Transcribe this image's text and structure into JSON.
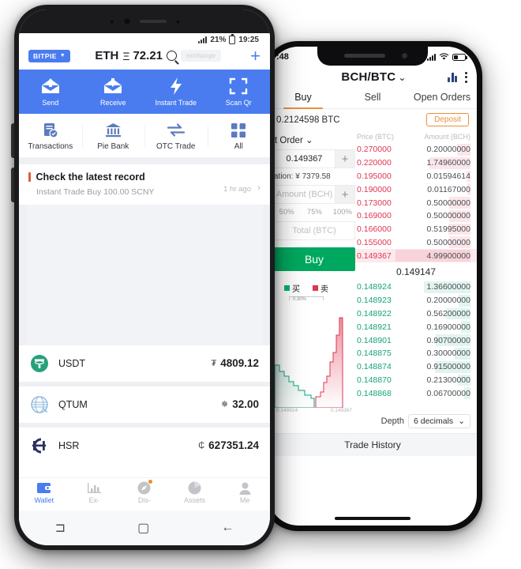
{
  "android": {
    "status": {
      "signal": "signal-bars",
      "battery_pct": "21%",
      "time": "19:25"
    },
    "header": {
      "wallet_chip": "BITPIE",
      "price_label": "ETH",
      "price_symbol": "Ξ",
      "price_value": "72.21",
      "search_placeholder": "exchange",
      "add_label": "+"
    },
    "actions": [
      {
        "label": "Send",
        "icon": "send-icon"
      },
      {
        "label": "Receive",
        "icon": "receive-icon"
      },
      {
        "label": "Instant Trade",
        "icon": "lightning-icon"
      },
      {
        "label": "Scan Qr",
        "icon": "scan-icon"
      }
    ],
    "quick": [
      {
        "label": "Transactions",
        "icon": "transactions-icon"
      },
      {
        "label": "Pie Bank",
        "icon": "bank-icon"
      },
      {
        "label": "OTC Trade",
        "icon": "exchange-arrows-icon"
      },
      {
        "label": "All",
        "icon": "grid-icon"
      }
    ],
    "record": {
      "title": "Check the latest record",
      "subtitle": "Instant Trade Buy 100.00 SCNY",
      "time": "1 hr ago",
      "chevron": "›"
    },
    "coins": [
      {
        "name": "USDT",
        "symbol": "₮",
        "amount": "4809.12",
        "color": "#26a17b",
        "icon": "usdt-icon"
      },
      {
        "name": "QTUM",
        "symbol": "✵",
        "amount": "32.00",
        "color": "#8ab9dd",
        "icon": "qtum-icon"
      },
      {
        "name": "HSR",
        "symbol": "₵",
        "amount": "627351.24",
        "color": "#2d3160",
        "icon": "hsr-icon"
      }
    ],
    "tabbar": [
      {
        "label": "Wallet",
        "icon": "wallet-icon",
        "active": true,
        "badge": false
      },
      {
        "label": "Ex-",
        "icon": "chart-icon",
        "active": false,
        "badge": false
      },
      {
        "label": "Dis-",
        "icon": "compass-icon",
        "active": false,
        "badge": true
      },
      {
        "label": "Assets",
        "icon": "pie-icon",
        "active": false,
        "badge": false
      },
      {
        "label": "Me",
        "icon": "person-icon",
        "active": false,
        "badge": false
      }
    ],
    "navbar": [
      {
        "icon": "recent-apps-icon",
        "glyph": "⊐"
      },
      {
        "icon": "home-icon",
        "glyph": "▢"
      },
      {
        "icon": "back-icon",
        "glyph": "←"
      }
    ]
  },
  "iphone": {
    "status": {
      "time": ":48",
      "signal": "signal-bars",
      "wifi": "wifi-icon",
      "battery": "battery-icon"
    },
    "header": {
      "pair": "BCH/BTC",
      "chevron": "⌄",
      "chart_icon": "chart-icon",
      "menu_icon": "kebab-menu-icon"
    },
    "tabs": [
      {
        "label": "Buy",
        "active": true
      },
      {
        "label": "Sell",
        "active": false
      },
      {
        "label": "Open Orders",
        "active": false
      }
    ],
    "balance": {
      "amount": "0.2124598 BTC",
      "deposit_label": "Deposit"
    },
    "form": {
      "order_type": "t Order",
      "order_type_chevron": "⌄",
      "price_value": "0.149367",
      "plus": "+",
      "valuation": "ation: ¥ 7379.58",
      "amount_placeholder": "Amount (BCH)",
      "percentages": [
        "50%",
        "75%",
        "100%"
      ],
      "total_placeholder": "Total (BTC)",
      "submit_label": "Buy"
    },
    "legend": [
      {
        "label": "买",
        "color": "#00b36b"
      },
      {
        "label": "卖",
        "color": "#e03552"
      }
    ],
    "scale_label": "0.30%",
    "depth_axis": [
      "0.148924",
      "0.149367"
    ],
    "orderbook": {
      "col_price": "Price (BTC)",
      "col_amount": "Amount (BCH)",
      "last_price": "0.149147",
      "sells": [
        {
          "price": "0.270000",
          "amount": "0.20000000",
          "bar": 18
        },
        {
          "price": "0.220000",
          "amount": "1.74960000",
          "bar": 55
        },
        {
          "price": "0.195000",
          "amount": "0.01594614",
          "bar": 5
        },
        {
          "price": "0.190000",
          "amount": "0.01167000",
          "bar": 4
        },
        {
          "price": "0.173000",
          "amount": "0.50000000",
          "bar": 28
        },
        {
          "price": "0.169000",
          "amount": "0.50000000",
          "bar": 28
        },
        {
          "price": "0.166000",
          "amount": "0.51995000",
          "bar": 29
        },
        {
          "price": "0.155000",
          "amount": "0.50000000",
          "bar": 28
        },
        {
          "price": "0.149367",
          "amount": "4.99900000",
          "bar": 100
        }
      ],
      "buys": [
        {
          "price": "0.148924",
          "amount": "1.36600000",
          "bar": 62
        },
        {
          "price": "0.148923",
          "amount": "0.20000000",
          "bar": 16
        },
        {
          "price": "0.148922",
          "amount": "0.56200000",
          "bar": 32
        },
        {
          "price": "0.148921",
          "amount": "0.16900000",
          "bar": 13
        },
        {
          "price": "0.148901",
          "amount": "0.90700000",
          "bar": 46
        },
        {
          "price": "0.148875",
          "amount": "0.30000000",
          "bar": 21
        },
        {
          "price": "0.148874",
          "amount": "0.91500000",
          "bar": 47
        },
        {
          "price": "0.148870",
          "amount": "0.21300000",
          "bar": 17
        },
        {
          "price": "0.148868",
          "amount": "0.06700000",
          "bar": 8
        }
      ]
    },
    "footer": {
      "depth_label": "Depth",
      "depth_value": "6 decimals",
      "depth_chevron": "⌄",
      "trade_history": "Trade History"
    }
  },
  "colors": {
    "android_accent": "#4a7cf0",
    "iphone_buy": "#00a85f",
    "iphone_sell": "#e03552",
    "iphone_bid": "#13a37a",
    "iphone_tab_underline": "#e8913a"
  }
}
